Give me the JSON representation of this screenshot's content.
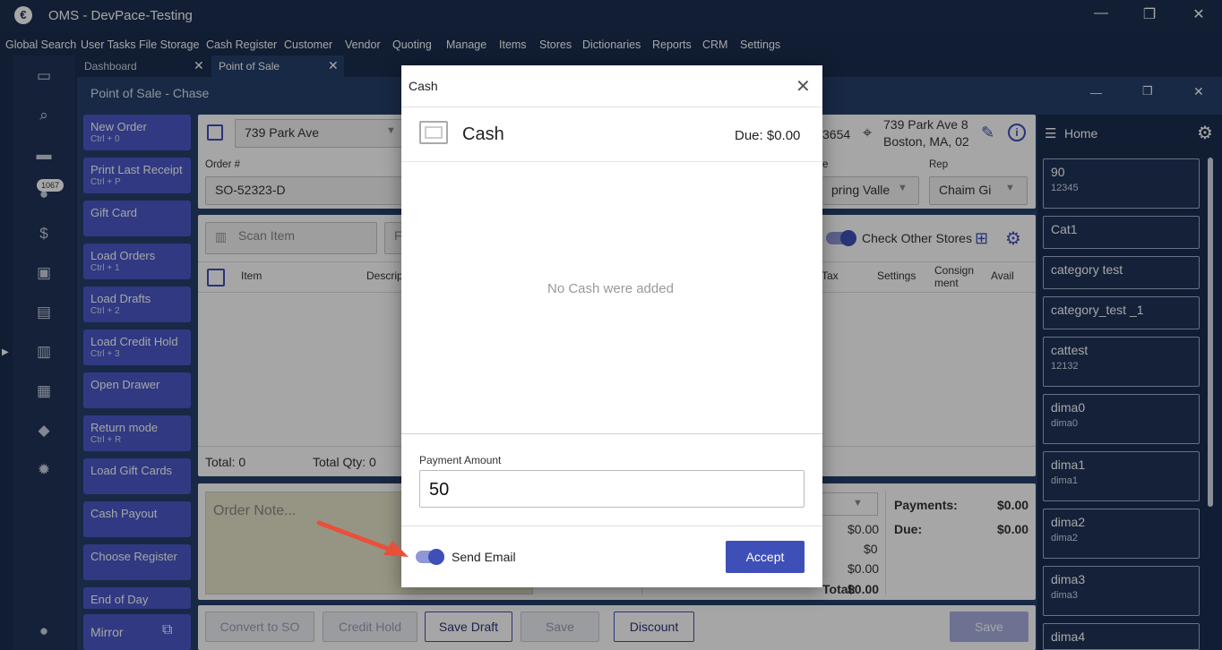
{
  "titlebar": {
    "title": "OMS - DevPace-Testing",
    "logo": "€",
    "minimize": "—",
    "restore": "❐",
    "close": "✕"
  },
  "menu": [
    "Global Search",
    "User Tasks",
    "File Storage",
    "Cash Register",
    "Customer",
    "Vendor",
    "Quoting",
    "Manage",
    "Items",
    "Stores",
    "Dictionaries",
    "Reports",
    "CRM",
    "Settings"
  ],
  "rail": {
    "badge": "1067"
  },
  "tabs": [
    {
      "label": "Dashboard"
    },
    {
      "label": "Point of Sale"
    }
  ],
  "window": {
    "title": "Point of Sale - Chase"
  },
  "commands": [
    {
      "label": "New Order",
      "shortcut": "Ctrl + 0"
    },
    {
      "label": "Print Last Receipt",
      "shortcut": "Ctrl + P"
    },
    {
      "label": "Gift Card",
      "shortcut": ""
    },
    {
      "label": "Load Orders",
      "shortcut": "Ctrl + 1"
    },
    {
      "label": "Load Drafts",
      "shortcut": "Ctrl + 2"
    },
    {
      "label": "Load Credit Hold",
      "shortcut": "Ctrl + 3"
    },
    {
      "label": "Open Drawer",
      "shortcut": ""
    },
    {
      "label": "Return mode",
      "shortcut": "Ctrl + R"
    },
    {
      "label": "Load Gift Cards",
      "shortcut": ""
    },
    {
      "label": "Cash Payout",
      "shortcut": ""
    },
    {
      "label": "Choose Register",
      "shortcut": ""
    },
    {
      "label": "End of Day",
      "shortcut": ""
    }
  ],
  "mirror": {
    "label": "Mirror"
  },
  "order": {
    "store": "739 Park Ave",
    "order_label": "Order #",
    "order_number": "SO-52323-D",
    "phone_tail": "3654",
    "address_line1": "739 Park Ave 8",
    "address_line2": "Boston, MA, 02",
    "store_field_label": "e",
    "store_field_value": "pring Valle",
    "rep_label": "Rep",
    "rep_value": "Chaim Gi"
  },
  "items": {
    "scan_placeholder": "Scan Item",
    "filter_placeholder": "F",
    "check_other_stores": "Check Other Stores",
    "columns": [
      "Item",
      "Descrip",
      "Tax",
      "Settings",
      "Consign ment",
      "Avail"
    ],
    "total_label": "Total: 0",
    "total_qty_label": "Total Qty: 0"
  },
  "summary": {
    "note_placeholder": "Order Note...",
    "values": [
      "$0.00",
      "$0",
      "$0.00"
    ],
    "total_label": "Total:",
    "total_value": "$0.00",
    "payments_label": "Payments:",
    "payments_value": "$0.00",
    "due_label": "Due:",
    "due_value": "$0.00"
  },
  "bottom_buttons": {
    "convert": "Convert to SO",
    "credit_hold": "Credit Hold",
    "save_draft": "Save Draft",
    "save": "Save",
    "discount": "Discount",
    "save_main": "Save"
  },
  "home": {
    "title": "Home",
    "categories": [
      {
        "name": "90",
        "code": "12345"
      },
      {
        "name": "Cat1",
        "code": ""
      },
      {
        "name": "category test",
        "code": ""
      },
      {
        "name": "category_test _1",
        "code": ""
      },
      {
        "name": "cattest",
        "code": "12132"
      },
      {
        "name": "dima0",
        "code": "dima0"
      },
      {
        "name": "dima1",
        "code": "dima1"
      },
      {
        "name": "dima2",
        "code": "dima2"
      },
      {
        "name": "dima3",
        "code": "dima3"
      },
      {
        "name": "dima4",
        "code": ""
      }
    ]
  },
  "modal": {
    "title": "Cash",
    "heading": "Cash",
    "due": "Due: $0.00",
    "empty": "No Cash were added",
    "amount_label": "Payment Amount",
    "amount_value": "50",
    "send_email": "Send Email",
    "accept": "Accept"
  },
  "colors": {
    "accent": "#4a58c8",
    "background": "#1a2d4e",
    "panel": "#25406b"
  }
}
